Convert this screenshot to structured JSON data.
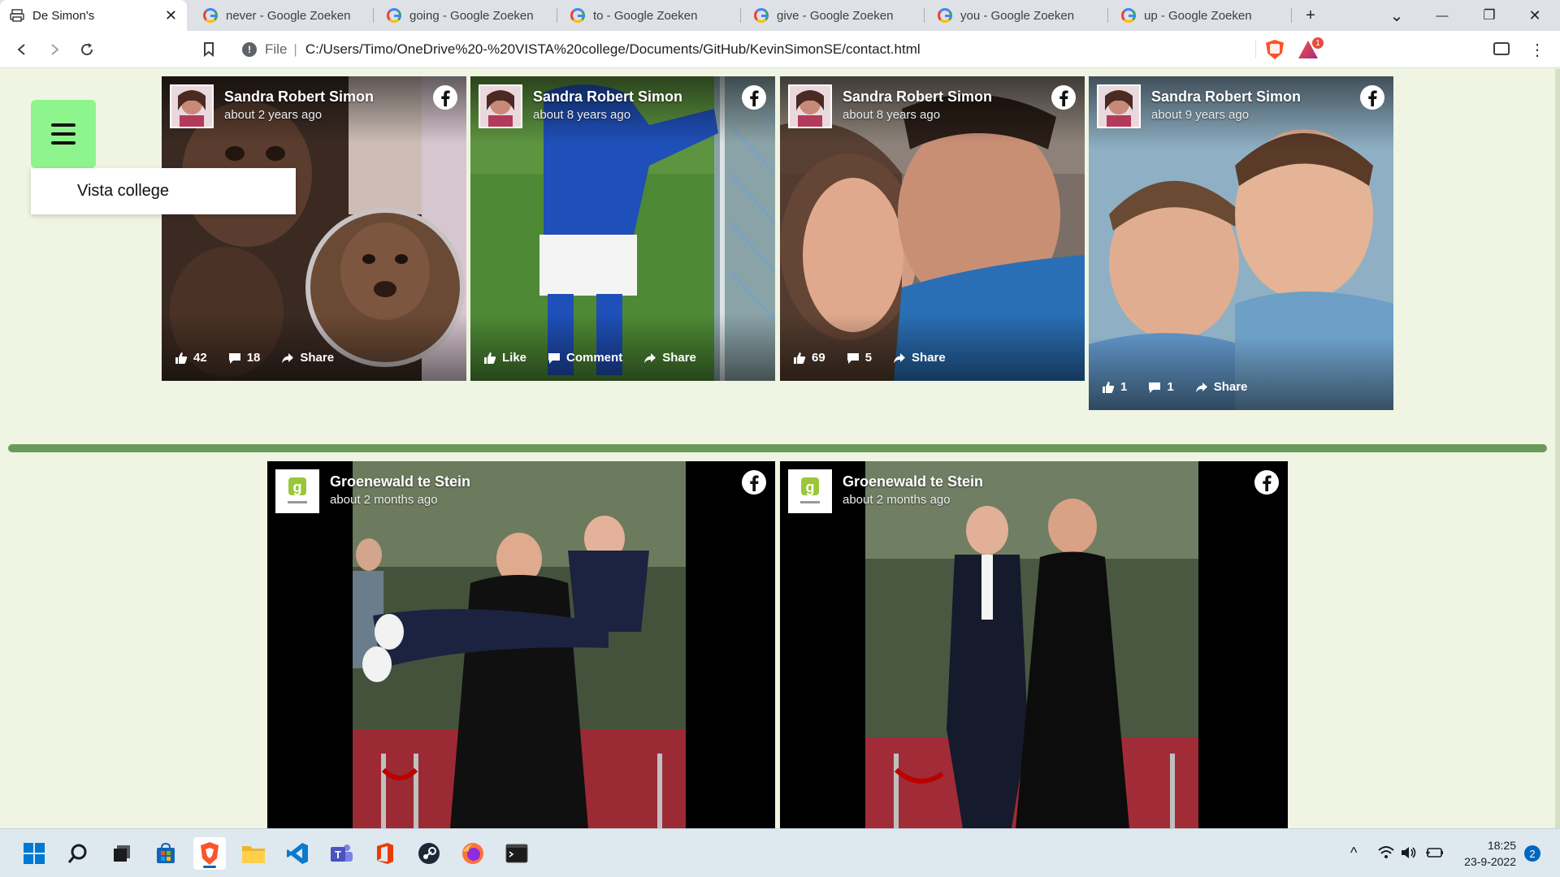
{
  "browser": {
    "tabs": [
      {
        "title": "De Simon's",
        "active": true
      },
      {
        "title": "never - Google Zoeken",
        "active": false
      },
      {
        "title": "going - Google Zoeken",
        "active": false
      },
      {
        "title": "to - Google Zoeken",
        "active": false
      },
      {
        "title": "give - Google Zoeken",
        "active": false
      },
      {
        "title": "you - Google Zoeken",
        "active": false
      },
      {
        "title": "up - Google Zoeken",
        "active": false
      }
    ],
    "new_tab_glyph": "+",
    "tab_list_glyph": "⌄",
    "window_controls": {
      "minimize": "—",
      "restore": "❐",
      "close": "✕"
    },
    "address": {
      "scheme_label": "File",
      "separator": "|",
      "url": "C:/Users/Timo/OneDrive%20-%20VISTA%20college/Documents/GitHub/KevinSimonSE/contact.html"
    },
    "rewards_badge": "1",
    "icons": [
      "back-icon",
      "forward-icon",
      "reload-icon",
      "bookmark-icon",
      "info-icon",
      "brave-shields-icon",
      "brave-rewards-icon",
      "wallet-icon",
      "menu-kebab-icon"
    ]
  },
  "menu": {
    "dropdown_items": [
      "Vista college"
    ]
  },
  "posts_top": [
    {
      "author": "Sandra Robert Simon",
      "time": "about 2 years ago",
      "actions": [
        "42",
        "18",
        "Share"
      ]
    },
    {
      "author": "Sandra Robert Simon",
      "time": "about 8 years ago",
      "actions": [
        "Like",
        "Comment",
        "Share"
      ]
    },
    {
      "author": "Sandra Robert Simon",
      "time": "about 8 years ago",
      "actions": [
        "69",
        "5",
        "Share"
      ]
    },
    {
      "author": "Sandra Robert Simon",
      "time": "about 9 years ago",
      "actions": [
        "1",
        "1",
        "Share"
      ]
    }
  ],
  "posts_bottom": [
    {
      "author": "Groenewald te Stein",
      "time": "about 2 months ago"
    },
    {
      "author": "Groenewald te Stein",
      "time": "about 2 months ago"
    }
  ],
  "colors": {
    "page_bg": "#f0f4e2",
    "menu_button": "#8ef58e",
    "divider": "#6a9a5b",
    "facebook": "#1877f2"
  },
  "taskbar": {
    "apps": [
      "windows-start-icon",
      "search-icon",
      "task-view-icon",
      "microsoft-store-icon",
      "brave-browser-icon",
      "file-explorer-icon",
      "vscode-icon",
      "teams-icon",
      "office-icon",
      "steam-icon",
      "firefox-icon",
      "terminal-icon"
    ],
    "tray": {
      "chevron": "^",
      "time": "18:25",
      "date": "23-9-2022",
      "notifications": "2"
    }
  }
}
